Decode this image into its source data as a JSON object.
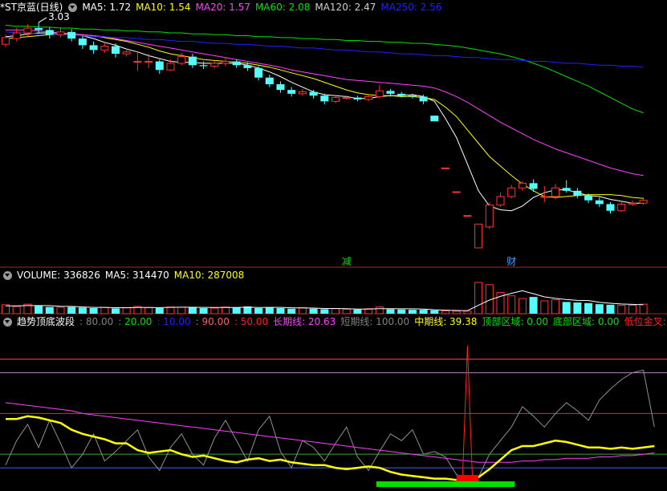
{
  "chart_data": [
    {
      "type": "candlestick",
      "header": {
        "title": "*ST京蓝(日线)"
      },
      "ma_labels": [
        {
          "label": "MA5: 1.72",
          "color": "#ffffff"
        },
        {
          "label": "MA10: 1.54",
          "color": "#ffff00"
        },
        {
          "label": "MA20: 1.57",
          "color": "#ff40ff"
        },
        {
          "label": "MA60: 2.08",
          "color": "#00e000"
        },
        {
          "label": "MA120: 2.47",
          "color": "#d0d0d0"
        },
        {
          "label": "MA250: 2.56",
          "color": "#2020ff"
        }
      ],
      "high_annotation": "3.03",
      "markers": [
        {
          "text": "减",
          "color": "#00e000"
        },
        {
          "text": "财",
          "color": "#40a0ff"
        }
      ],
      "candles": [
        [
          2.8,
          2.87,
          2.9,
          2.77
        ],
        [
          2.86,
          2.92,
          2.97,
          2.83
        ],
        [
          2.92,
          2.97,
          3.01,
          2.88
        ],
        [
          2.97,
          2.95,
          3.03,
          2.91
        ],
        [
          2.95,
          2.9,
          2.98,
          2.86
        ],
        [
          2.9,
          2.93,
          2.98,
          2.87
        ],
        [
          2.93,
          2.86,
          2.96,
          2.83
        ],
        [
          2.86,
          2.79,
          2.89,
          2.75
        ],
        [
          2.79,
          2.74,
          2.83,
          2.7
        ],
        [
          2.74,
          2.78,
          2.82,
          2.71
        ],
        [
          2.78,
          2.7,
          2.81,
          2.66
        ],
        [
          2.7,
          2.72,
          2.76,
          2.67
        ],
        [
          2.62,
          2.62,
          2.72,
          2.52
        ],
        [
          2.62,
          2.62,
          2.7,
          2.55
        ],
        [
          2.62,
          2.53,
          2.64,
          2.49
        ],
        [
          2.53,
          2.6,
          2.64,
          2.52
        ],
        [
          2.6,
          2.67,
          2.71,
          2.58
        ],
        [
          2.67,
          2.58,
          2.7,
          2.55
        ],
        [
          2.58,
          2.57,
          2.62,
          2.54
        ],
        [
          2.57,
          2.6,
          2.63,
          2.55
        ],
        [
          2.6,
          2.62,
          2.66,
          2.57
        ],
        [
          2.62,
          2.58,
          2.64,
          2.55
        ],
        [
          2.58,
          2.55,
          2.61,
          2.52
        ],
        [
          2.55,
          2.45,
          2.57,
          2.42
        ],
        [
          2.45,
          2.38,
          2.48,
          2.35
        ],
        [
          2.38,
          2.32,
          2.41,
          2.29
        ],
        [
          2.32,
          2.28,
          2.35,
          2.25
        ],
        [
          2.28,
          2.3,
          2.33,
          2.26
        ],
        [
          2.3,
          2.26,
          2.32,
          2.23
        ],
        [
          2.26,
          2.2,
          2.28,
          2.17
        ],
        [
          2.2,
          2.24,
          2.27,
          2.18
        ],
        [
          2.24,
          2.24,
          2.26,
          2.22
        ],
        [
          2.24,
          2.22,
          2.26,
          2.2
        ],
        [
          2.22,
          2.25,
          2.28,
          2.2
        ],
        [
          2.25,
          2.31,
          2.37,
          2.23
        ],
        [
          2.31,
          2.28,
          2.33,
          2.25
        ],
        [
          2.28,
          2.26,
          2.3,
          2.24
        ],
        [
          2.26,
          2.25,
          2.28,
          2.23
        ],
        [
          2.25,
          2.2,
          2.27,
          2.17
        ],
        [
          2.05,
          1.99,
          2.05,
          1.99
        ],
        [
          1.5,
          1.5,
          1.5,
          1.5
        ],
        [
          1.25,
          1.25,
          1.25,
          1.25
        ],
        [
          1.0,
          1.0,
          1.0,
          1.0
        ],
        [
          0.66,
          0.91,
          0.91,
          0.66
        ],
        [
          0.88,
          1.11,
          1.14,
          0.86
        ],
        [
          1.11,
          1.2,
          1.24,
          1.09
        ],
        [
          1.2,
          1.29,
          1.32,
          1.18
        ],
        [
          1.29,
          1.34,
          1.36,
          1.26
        ],
        [
          1.34,
          1.28,
          1.38,
          1.25
        ],
        [
          1.2,
          1.2,
          1.31,
          1.14
        ],
        [
          1.2,
          1.29,
          1.33,
          1.17
        ],
        [
          1.29,
          1.26,
          1.37,
          1.24
        ],
        [
          1.26,
          1.21,
          1.29,
          1.18
        ],
        [
          1.21,
          1.16,
          1.23,
          1.13
        ],
        [
          1.16,
          1.12,
          1.19,
          1.09
        ],
        [
          1.12,
          1.05,
          1.14,
          1.02
        ],
        [
          1.05,
          1.12,
          1.14,
          1.04
        ],
        [
          1.12,
          1.13,
          1.16,
          1.1
        ],
        [
          1.13,
          1.16,
          1.19,
          1.11
        ]
      ],
      "ma_lines": [
        {
          "name": "MA5",
          "color": "#ffffff",
          "values": [
            2.88,
            2.89,
            2.91,
            2.92,
            2.92,
            2.92,
            2.91,
            2.89,
            2.86,
            2.82,
            2.79,
            2.75,
            2.72,
            2.68,
            2.65,
            2.62,
            2.61,
            2.61,
            2.6,
            2.6,
            2.6,
            2.6,
            2.58,
            2.55,
            2.51,
            2.46,
            2.4,
            2.35,
            2.3,
            2.27,
            2.26,
            2.25,
            2.23,
            2.23,
            2.25,
            2.26,
            2.26,
            2.27,
            2.25,
            2.2,
            2.02,
            1.82,
            1.54,
            1.26,
            1.1,
            1.06,
            1.05,
            1.1,
            1.19,
            1.24,
            1.27,
            1.27,
            1.24,
            1.21,
            1.2,
            1.17,
            1.15,
            1.13,
            1.13
          ]
        },
        {
          "name": "MA10",
          "color": "#ffff00",
          "values": [
            2.86,
            2.87,
            2.88,
            2.89,
            2.9,
            2.91,
            2.91,
            2.9,
            2.89,
            2.87,
            2.85,
            2.83,
            2.8,
            2.77,
            2.73,
            2.7,
            2.68,
            2.66,
            2.64,
            2.63,
            2.62,
            2.61,
            2.6,
            2.58,
            2.56,
            2.53,
            2.5,
            2.47,
            2.44,
            2.4,
            2.36,
            2.32,
            2.29,
            2.27,
            2.26,
            2.26,
            2.25,
            2.25,
            2.24,
            2.22,
            2.14,
            2.04,
            1.9,
            1.76,
            1.62,
            1.52,
            1.42,
            1.33,
            1.26,
            1.2,
            1.19,
            1.2,
            1.21,
            1.22,
            1.22,
            1.22,
            1.21,
            1.19,
            1.18
          ]
        },
        {
          "name": "MA20",
          "color": "#ff40ff",
          "values": [
            2.95,
            2.95,
            2.95,
            2.94,
            2.93,
            2.92,
            2.91,
            2.9,
            2.89,
            2.88,
            2.86,
            2.84,
            2.82,
            2.8,
            2.78,
            2.76,
            2.74,
            2.72,
            2.7,
            2.68,
            2.66,
            2.64,
            2.62,
            2.6,
            2.58,
            2.56,
            2.53,
            2.51,
            2.49,
            2.47,
            2.45,
            2.43,
            2.42,
            2.41,
            2.4,
            2.39,
            2.38,
            2.37,
            2.36,
            2.34,
            2.3,
            2.25,
            2.19,
            2.12,
            2.05,
            1.98,
            1.92,
            1.86,
            1.8,
            1.75,
            1.7,
            1.66,
            1.62,
            1.58,
            1.54,
            1.5,
            1.47,
            1.44,
            1.42
          ]
        },
        {
          "name": "MA60",
          "color": "#00e000",
          "values": [
            3.0,
            2.99,
            2.99,
            2.98,
            2.98,
            2.97,
            2.97,
            2.96,
            2.96,
            2.95,
            2.95,
            2.94,
            2.94,
            2.93,
            2.93,
            2.92,
            2.92,
            2.91,
            2.91,
            2.9,
            2.9,
            2.89,
            2.89,
            2.88,
            2.88,
            2.87,
            2.87,
            2.86,
            2.86,
            2.85,
            2.85,
            2.84,
            2.84,
            2.83,
            2.83,
            2.82,
            2.82,
            2.81,
            2.81,
            2.8,
            2.79,
            2.78,
            2.76,
            2.74,
            2.72,
            2.7,
            2.67,
            2.64,
            2.6,
            2.56,
            2.51,
            2.46,
            2.41,
            2.36,
            2.3,
            2.24,
            2.18,
            2.12,
            2.08
          ]
        },
        {
          "name": "MA250",
          "color": "#2020ff",
          "values": [
            2.93,
            2.92,
            2.92,
            2.91,
            2.91,
            2.9,
            2.9,
            2.89,
            2.88,
            2.88,
            2.87,
            2.87,
            2.86,
            2.85,
            2.85,
            2.84,
            2.83,
            2.83,
            2.82,
            2.81,
            2.81,
            2.8,
            2.8,
            2.79,
            2.78,
            2.78,
            2.77,
            2.76,
            2.76,
            2.75,
            2.74,
            2.74,
            2.73,
            2.72,
            2.72,
            2.71,
            2.7,
            2.7,
            2.69,
            2.68,
            2.68,
            2.67,
            2.66,
            2.66,
            2.65,
            2.64,
            2.64,
            2.63,
            2.62,
            2.62,
            2.61,
            2.6,
            2.6,
            2.59,
            2.58,
            2.58,
            2.57,
            2.57,
            2.56
          ]
        }
      ]
    },
    {
      "type": "bar",
      "header": {
        "items": [
          {
            "label": "VOLUME: 336826",
            "color": "#ffffff"
          },
          {
            "label": "MA5: 314470",
            "color": "#ffffff"
          },
          {
            "label": "MA10: 287008",
            "color": "#ffff00"
          }
        ]
      },
      "values": [
        160000,
        130000,
        170000,
        140000,
        120000,
        115000,
        120000,
        110000,
        100000,
        115000,
        95000,
        110000,
        130000,
        110000,
        100000,
        120000,
        115000,
        120000,
        100000,
        100000,
        120000,
        110000,
        130000,
        100000,
        110000,
        100000,
        90000,
        110000,
        90000,
        80000,
        90000,
        80000,
        75000,
        90000,
        120000,
        80000,
        75000,
        70000,
        70000,
        60000,
        50000,
        45000,
        45000,
        560000,
        520000,
        380000,
        320000,
        270000,
        300000,
        230000,
        250000,
        210000,
        200000,
        190000,
        170000,
        160000,
        150000,
        150000,
        170000
      ],
      "ma5": [
        140000,
        140000,
        145000,
        145000,
        144000,
        133000,
        130000,
        121000,
        113000,
        112000,
        108000,
        106000,
        110000,
        112000,
        109000,
        113000,
        117000,
        115000,
        113000,
        111000,
        111000,
        110000,
        116000,
        112000,
        114000,
        114000,
        106000,
        102000,
        100000,
        94000,
        94000,
        90000,
        83000,
        82000,
        90000,
        89000,
        87000,
        87000,
        83000,
        71000,
        63000,
        58000,
        54000,
        152000,
        244000,
        310000,
        365000,
        410000,
        358000,
        301000,
        274000,
        252000,
        238000,
        236000,
        204000,
        186000,
        174000,
        166000,
        160000
      ]
    },
    {
      "type": "line",
      "header": {
        "items": [
          {
            "label": "趋势顶底波段",
            "color": "#ffffff"
          },
          {
            "label": ": 80.00",
            "color": "#808080"
          },
          {
            "label": ": 20.00",
            "color": "#00e000"
          },
          {
            "label": ": 10.00",
            "color": "#2020ff"
          },
          {
            "label": ": 90.00",
            "color": "#ff6060"
          },
          {
            "label": ": 50.00",
            "color": "#ff2020"
          },
          {
            "label": "长期线: 20.63",
            "color": "#ff40ff"
          },
          {
            "label": "短期线: 100.00",
            "color": "#808080"
          },
          {
            "label": "中期线: 39.38",
            "color": "#ffff00"
          },
          {
            "label": "顶部区域: 0.00",
            "color": "#00e000"
          },
          {
            "label": "底部区域: 0.00",
            "color": "#00e000"
          },
          {
            "label": "低位金叉: 0.00",
            "color": "#ff2020"
          }
        ]
      },
      "reference_lines": [
        {
          "value": 90,
          "color": "#ff5050"
        },
        {
          "value": 80,
          "color": "#c080c0"
        },
        {
          "value": 50,
          "color": "#ff2020"
        },
        {
          "value": 20,
          "color": "#40a040"
        },
        {
          "value": 10,
          "color": "#4060ff"
        }
      ],
      "long_line": [
        58,
        57,
        56,
        55,
        54,
        53,
        52,
        50,
        49,
        48,
        47,
        46,
        45,
        44,
        43,
        42,
        41,
        40,
        39,
        38,
        37,
        36,
        35,
        34,
        33,
        32,
        31,
        30,
        29,
        28,
        27,
        26,
        25,
        24,
        23,
        22,
        21,
        20,
        19,
        18,
        17,
        16,
        15,
        14,
        14,
        14,
        14,
        15,
        15,
        16,
        16,
        17,
        17,
        17,
        18,
        18,
        19,
        19,
        20,
        21
      ],
      "mid_line": [
        46,
        46,
        48,
        47,
        45,
        43,
        38,
        35,
        33,
        31,
        28,
        28,
        23,
        21,
        22,
        23,
        20,
        18,
        19,
        17,
        15,
        14,
        16,
        17,
        15,
        16,
        14,
        13,
        12,
        12,
        10,
        9,
        10,
        11,
        10,
        7,
        5,
        4,
        3,
        2,
        2,
        1,
        1,
        3,
        9,
        16,
        23,
        26,
        26,
        28,
        30,
        29,
        27,
        25,
        25,
        24,
        25,
        24,
        25,
        26
      ],
      "short_line": [
        12,
        30,
        42,
        25,
        45,
        28,
        10,
        20,
        35,
        15,
        22,
        30,
        38,
        18,
        8,
        25,
        35,
        20,
        12,
        32,
        45,
        30,
        15,
        38,
        48,
        22,
        10,
        30,
        25,
        15,
        28,
        40,
        18,
        8,
        22,
        35,
        30,
        38,
        20,
        22,
        18,
        5,
        2,
        3,
        20,
        30,
        40,
        55,
        48,
        40,
        50,
        58,
        52,
        45,
        60,
        68,
        75,
        80,
        82,
        40
      ],
      "bottom_green_range": [
        34,
        46
      ],
      "bottom_red_range": [
        41,
        43
      ],
      "golden_cross_spike": 100
    }
  ]
}
